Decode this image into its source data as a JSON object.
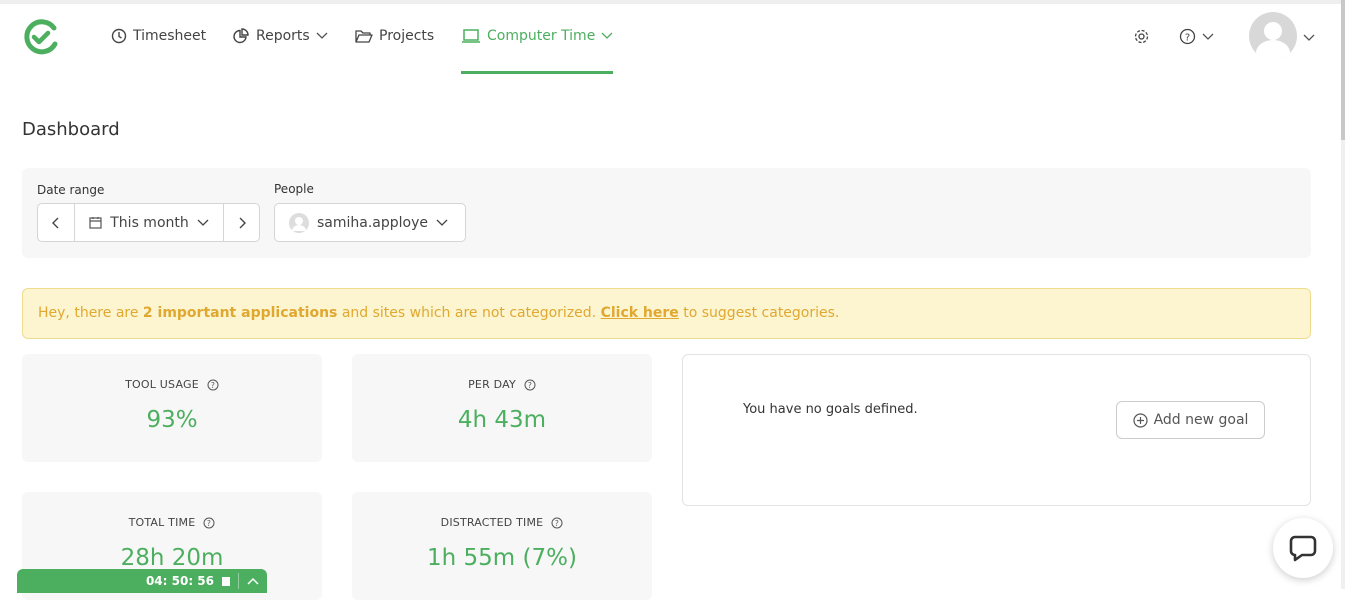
{
  "nav": {
    "items": [
      {
        "label": "Timesheet",
        "icon": "clock-icon"
      },
      {
        "label": "Reports",
        "icon": "pie-chart-icon"
      },
      {
        "label": "Projects",
        "icon": "folder-icon"
      },
      {
        "label": "Computer Time",
        "icon": "laptop-icon",
        "active": true
      }
    ]
  },
  "page": {
    "title": "Dashboard"
  },
  "filters": {
    "date_range_label": "Date range",
    "date_range_value": "This month",
    "people_label": "People",
    "people_value": "samiha.apploye"
  },
  "banner": {
    "pre": "Hey, there are ",
    "bold": "2 important applications",
    "mid": " and sites which are not categorized. ",
    "link": "Click here",
    "post": " to suggest categories."
  },
  "cards": [
    {
      "label": "TOOL USAGE",
      "value": "93%"
    },
    {
      "label": "PER DAY",
      "value": "4h 43m"
    },
    {
      "label": "TOTAL TIME",
      "value": "28h 20m"
    },
    {
      "label": "DISTRACTED TIME",
      "value": "1h 55m (7%)"
    }
  ],
  "goals": {
    "message": "You have no goals defined.",
    "add_label": "Add new goal"
  },
  "timer": {
    "value": "04: 50: 56"
  },
  "colors": {
    "accent": "#4caf5f",
    "banner_bg": "#fcf5d0",
    "banner_text": "#e0a830"
  }
}
